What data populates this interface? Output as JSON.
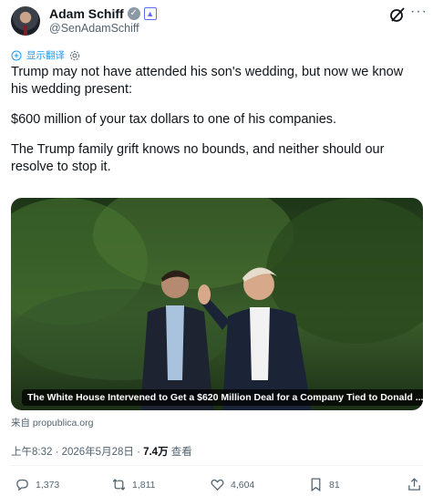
{
  "author": {
    "name": "Adam Schiff",
    "handle": "@SenAdamSchiff"
  },
  "translate_label": "显示翻译",
  "tweet": {
    "paragraphs": [
      "Trump may not have attended his son's wedding, but now we know his wedding present:",
      "$600 million of your tax dollars to one of his companies.",
      "The Trump family grift knows no bounds, and neither should our resolve to stop it."
    ]
  },
  "card": {
    "headline": "The White House Intervened to Get a $620 Million Deal for a Company Tied to Donald ...",
    "source": "来自 propublica.org"
  },
  "meta": {
    "time_date": "上午8:32 · 2026年5月28日 · ",
    "views_count": "7.4万",
    "views_label": " 查看"
  },
  "actions": {
    "replies": "1,373",
    "reposts": "1,811",
    "likes": "4,604",
    "bookmarks": "81"
  },
  "colors": {
    "link": "#1d9bf0",
    "secondary_text": "#536471",
    "primary_text": "#0f1419"
  }
}
